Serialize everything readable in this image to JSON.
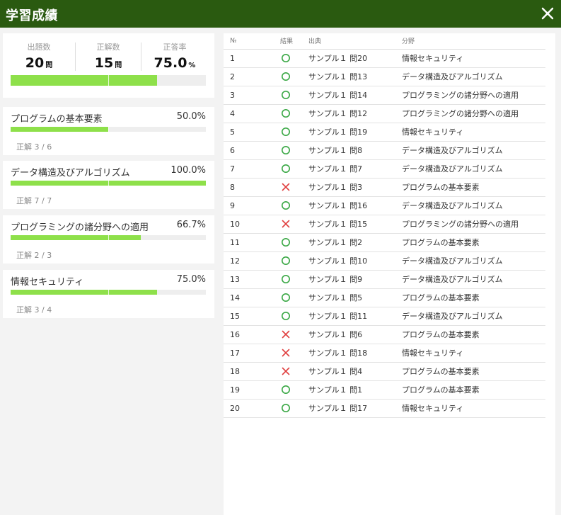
{
  "header": {
    "title": "学習成績"
  },
  "summary": {
    "stats": [
      {
        "label": "出題数",
        "value": "20",
        "unit": "問"
      },
      {
        "label": "正解数",
        "value": "15",
        "unit": "問"
      },
      {
        "label": "正答率",
        "value": "75.0",
        "unit": "%"
      }
    ],
    "progress": 0.75
  },
  "categories": [
    {
      "name": "プログラムの基本要素",
      "percent": "50.0%",
      "fraction": 0.5,
      "count": "正解 3 / 6"
    },
    {
      "name": "データ構造及びアルゴリズム",
      "percent": "100.0%",
      "fraction": 1.0,
      "count": "正解 7 / 7"
    },
    {
      "name": "プログラミングの諸分野への適用",
      "percent": "66.7%",
      "fraction": 0.667,
      "count": "正解 2 / 3"
    },
    {
      "name": "情報セキュリティ",
      "percent": "75.0%",
      "fraction": 0.75,
      "count": "正解 3 / 4"
    }
  ],
  "table": {
    "headers": {
      "no": "№",
      "result": "結果",
      "source": "出典",
      "field": "分野"
    },
    "rows": [
      {
        "no": "1",
        "correct": true,
        "source": "サンプル１ 問20",
        "field": "情報セキュリティ"
      },
      {
        "no": "2",
        "correct": true,
        "source": "サンプル１ 問13",
        "field": "データ構造及びアルゴリズム"
      },
      {
        "no": "3",
        "correct": true,
        "source": "サンプル１ 問14",
        "field": "プログラミングの諸分野への適用"
      },
      {
        "no": "4",
        "correct": true,
        "source": "サンプル１ 問12",
        "field": "プログラミングの諸分野への適用"
      },
      {
        "no": "5",
        "correct": true,
        "source": "サンプル１ 問19",
        "field": "情報セキュリティ"
      },
      {
        "no": "6",
        "correct": true,
        "source": "サンプル１ 問8",
        "field": "データ構造及びアルゴリズム"
      },
      {
        "no": "7",
        "correct": true,
        "source": "サンプル１ 問7",
        "field": "データ構造及びアルゴリズム"
      },
      {
        "no": "8",
        "correct": false,
        "source": "サンプル１ 問3",
        "field": "プログラムの基本要素"
      },
      {
        "no": "9",
        "correct": true,
        "source": "サンプル１ 問16",
        "field": "データ構造及びアルゴリズム"
      },
      {
        "no": "10",
        "correct": false,
        "source": "サンプル１ 問15",
        "field": "プログラミングの諸分野への適用"
      },
      {
        "no": "11",
        "correct": true,
        "source": "サンプル１ 問2",
        "field": "プログラムの基本要素"
      },
      {
        "no": "12",
        "correct": true,
        "source": "サンプル１ 問10",
        "field": "データ構造及びアルゴリズム"
      },
      {
        "no": "13",
        "correct": true,
        "source": "サンプル１ 問9",
        "field": "データ構造及びアルゴリズム"
      },
      {
        "no": "14",
        "correct": true,
        "source": "サンプル１ 問5",
        "field": "プログラムの基本要素"
      },
      {
        "no": "15",
        "correct": true,
        "source": "サンプル１ 問11",
        "field": "データ構造及びアルゴリズム"
      },
      {
        "no": "16",
        "correct": false,
        "source": "サンプル１ 問6",
        "field": "プログラムの基本要素"
      },
      {
        "no": "17",
        "correct": false,
        "source": "サンプル１ 問18",
        "field": "情報セキュリティ"
      },
      {
        "no": "18",
        "correct": false,
        "source": "サンプル１ 問4",
        "field": "プログラムの基本要素"
      },
      {
        "no": "19",
        "correct": true,
        "source": "サンプル１ 問1",
        "field": "プログラムの基本要素"
      },
      {
        "no": "20",
        "correct": true,
        "source": "サンプル１ 問17",
        "field": "情報セキュリティ"
      }
    ]
  },
  "colors": {
    "header": "#2a5a10",
    "progress": "#8ee04a",
    "correct": "#3aa845",
    "incorrect": "#e04040"
  },
  "icons": {
    "close": "close-icon",
    "correct": "circle-icon",
    "incorrect": "cross-icon"
  }
}
